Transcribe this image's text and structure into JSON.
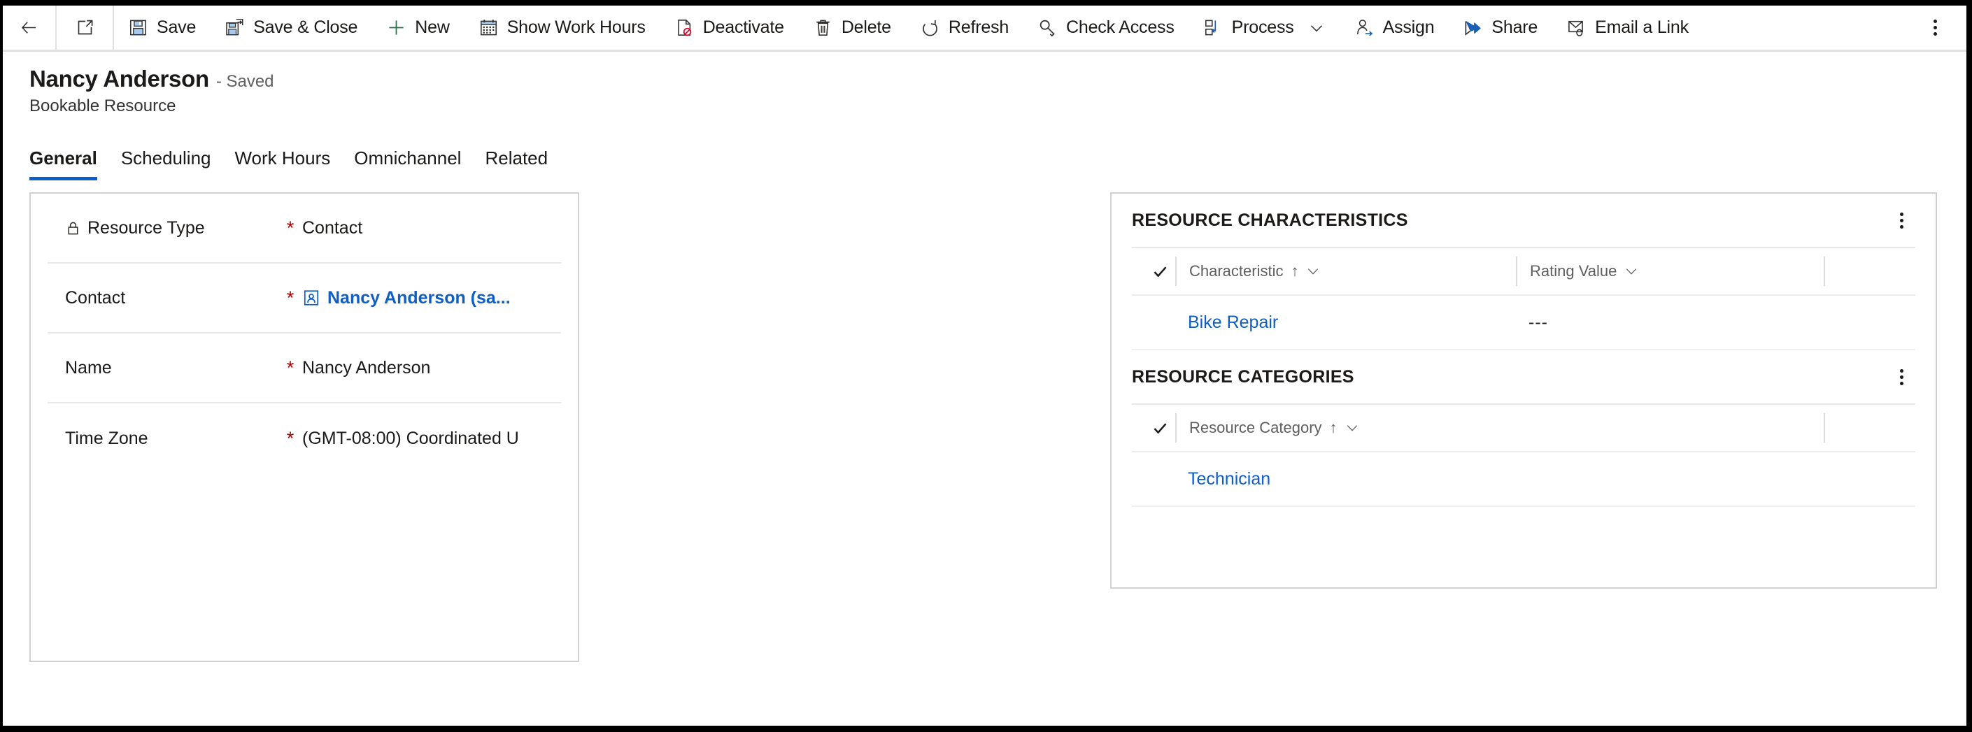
{
  "commandbar": {
    "back_label": "Back",
    "popout_label": "Open in new window",
    "buttons": [
      {
        "icon": "save-icon",
        "label": "Save"
      },
      {
        "icon": "save-and-close-icon",
        "label": "Save & Close"
      },
      {
        "icon": "new-icon",
        "label": "New"
      },
      {
        "icon": "show-work-hours-icon",
        "label": "Show Work Hours"
      },
      {
        "icon": "deactivate-icon",
        "label": "Deactivate"
      },
      {
        "icon": "delete-icon",
        "label": "Delete"
      },
      {
        "icon": "refresh-icon",
        "label": "Refresh"
      },
      {
        "icon": "check-access-icon",
        "label": "Check Access"
      },
      {
        "icon": "process-icon",
        "label": "Process",
        "chevron": true
      },
      {
        "icon": "assign-icon",
        "label": "Assign"
      },
      {
        "icon": "share-icon",
        "label": "Share"
      },
      {
        "icon": "email-a-link-icon",
        "label": "Email a Link"
      }
    ],
    "overflow_label": "More commands"
  },
  "header": {
    "title": "Nancy Anderson",
    "saved_status": "- Saved",
    "entity": "Bookable Resource"
  },
  "tabs": [
    {
      "label": "General",
      "active": true
    },
    {
      "label": "Scheduling",
      "active": false
    },
    {
      "label": "Work Hours",
      "active": false
    },
    {
      "label": "Omnichannel",
      "active": false
    },
    {
      "label": "Related",
      "active": false
    }
  ],
  "form": {
    "fields": [
      {
        "label": "Resource Type",
        "locked": true,
        "required": "*",
        "value": "Contact",
        "is_link": false
      },
      {
        "label": "Contact",
        "locked": false,
        "required": "*",
        "value": "Nancy Anderson (sa...",
        "is_link": true
      },
      {
        "label": "Name",
        "locked": false,
        "required": "*",
        "value": "Nancy Anderson",
        "is_link": false
      },
      {
        "label": "Time Zone",
        "locked": false,
        "required": "*",
        "value": "(GMT-08:00) Coordinated U",
        "is_link": false
      }
    ]
  },
  "characteristics": {
    "title": "RESOURCE CHARACTERISTICS",
    "columns": [
      {
        "label": "Characteristic",
        "sorted": "↑"
      },
      {
        "label": "Rating Value",
        "sorted": ""
      }
    ],
    "rows": [
      {
        "characteristic": "Bike Repair",
        "rating_value": "---"
      }
    ]
  },
  "categories": {
    "title": "RESOURCE CATEGORIES",
    "columns": [
      {
        "label": "Resource Category",
        "sorted": "↑"
      }
    ],
    "rows": [
      {
        "resource_category": "Technician"
      }
    ]
  },
  "colors": {
    "accent": "#0f5ec4",
    "required": "#a80000",
    "text": "#1b1a19",
    "muted": "#5e5e5e",
    "border": "#d1d1d1"
  }
}
